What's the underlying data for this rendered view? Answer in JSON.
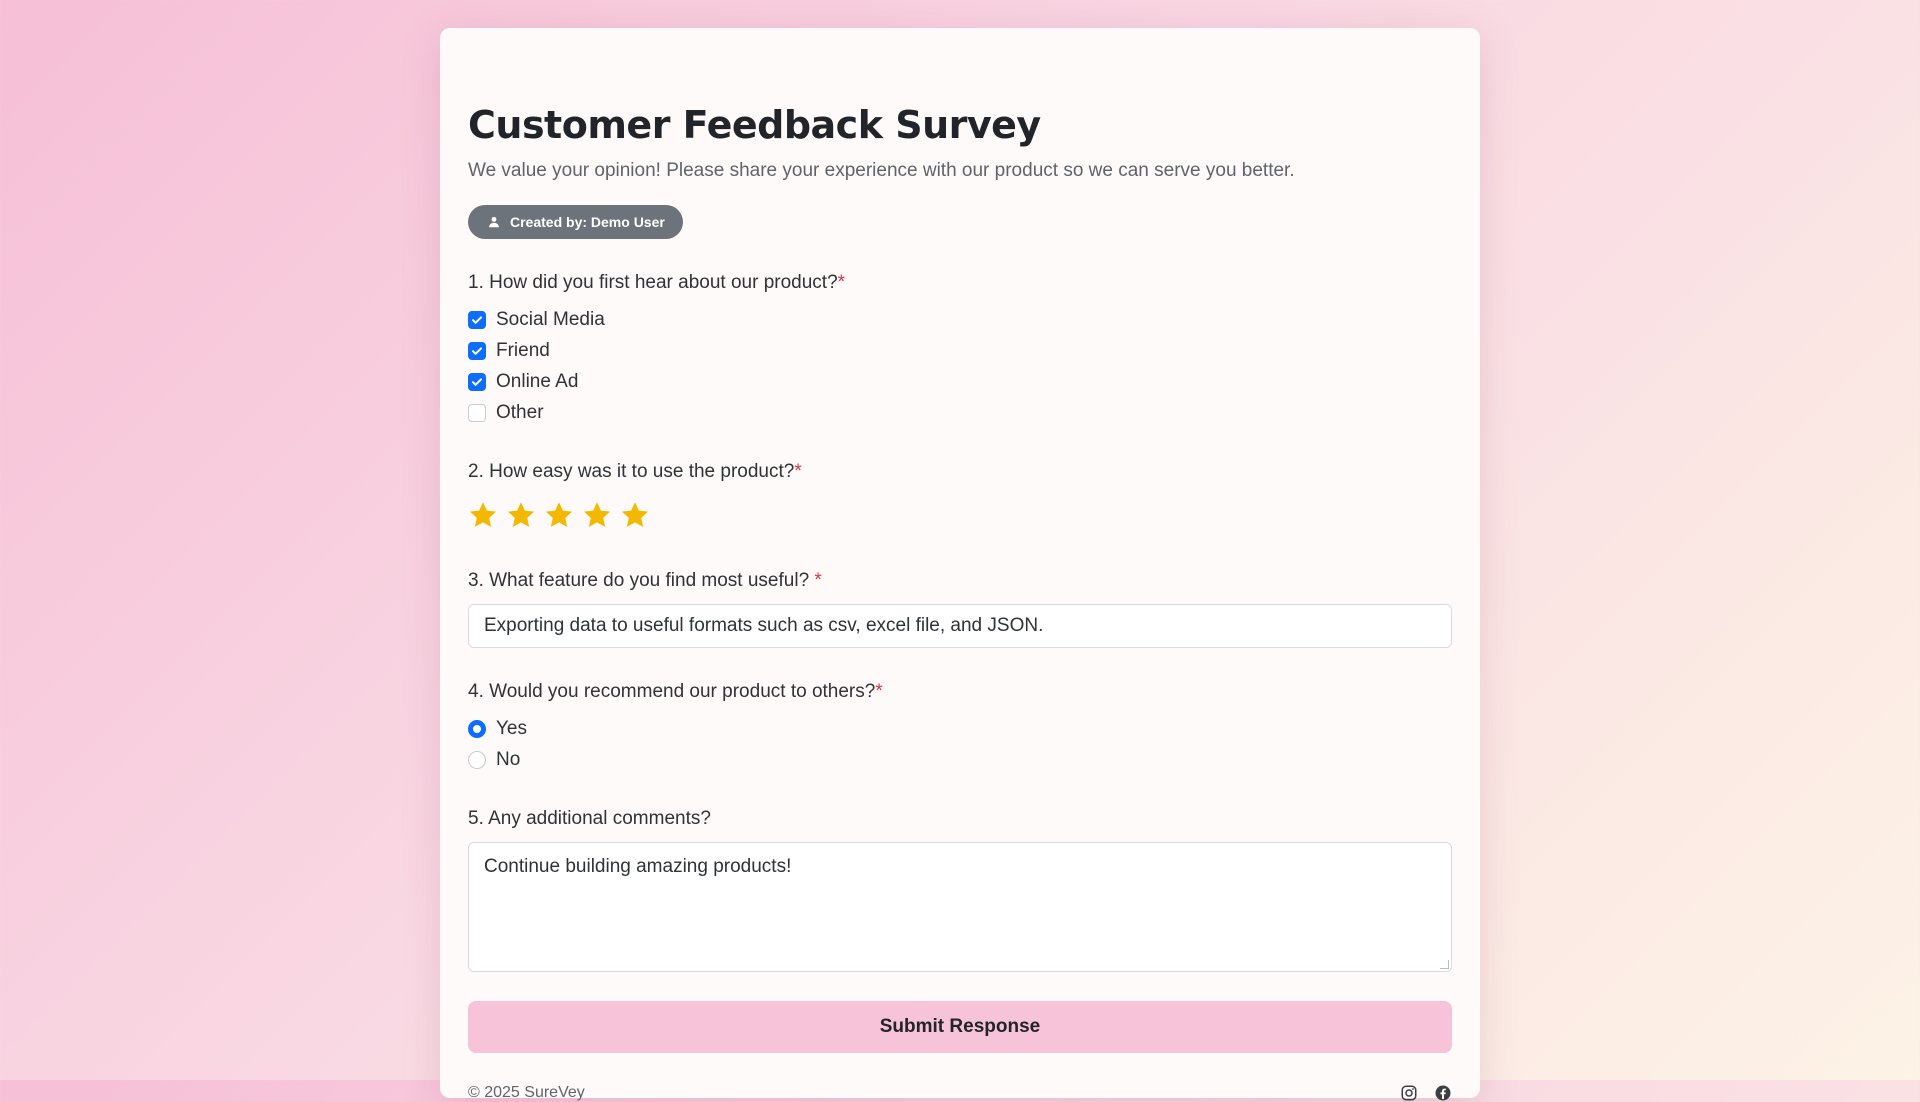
{
  "survey": {
    "title": "Customer Feedback Survey",
    "description": "We value your opinion! Please share your experience with our product so we can serve you better.",
    "created_by": "Created by: Demo User"
  },
  "questions": {
    "q1": {
      "label": "1. How did you first hear about our product?",
      "required_mark": "*",
      "options": [
        {
          "label": "Social Media",
          "checked": true
        },
        {
          "label": "Friend",
          "checked": true
        },
        {
          "label": "Online Ad",
          "checked": true
        },
        {
          "label": "Other",
          "checked": false
        }
      ]
    },
    "q2": {
      "label": "2. How easy was it to use the product?",
      "required_mark": "*",
      "rating": 5,
      "rating_max": 5
    },
    "q3": {
      "label": "3. What feature do you find most useful? ",
      "required_mark": "*",
      "value": "Exporting data to useful formats such as csv, excel file, and JSON."
    },
    "q4": {
      "label": "4. Would you recommend our product to others?",
      "required_mark": "*",
      "options": [
        {
          "label": "Yes",
          "selected": true
        },
        {
          "label": "No",
          "selected": false
        }
      ]
    },
    "q5": {
      "label": "5. Any additional comments?",
      "value": "Continue building amazing products!"
    }
  },
  "submit_label": "Submit Response",
  "footer": {
    "copyright": "© 2025 SureVey",
    "icons": [
      "instagram-icon",
      "facebook-icon"
    ]
  },
  "colors": {
    "accent": "#0d6efd",
    "required": "#dc3545",
    "star": "#f5b800",
    "submit_bg": "#f7c3d8",
    "badge_bg": "#6c737a"
  }
}
